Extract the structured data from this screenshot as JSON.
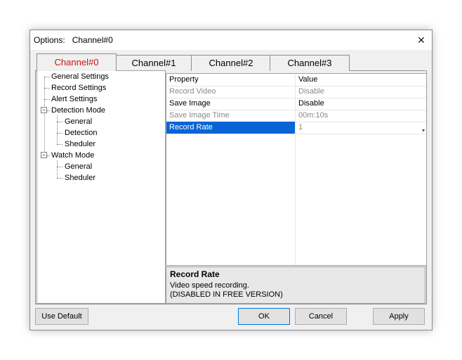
{
  "window": {
    "title": "Options:   Channel#0",
    "close_glyph": "✕"
  },
  "tabs": [
    {
      "label": "Channel#0",
      "active": true
    },
    {
      "label": "Channel#1",
      "active": false
    },
    {
      "label": "Channel#2",
      "active": false
    },
    {
      "label": "Channel#3",
      "active": false
    }
  ],
  "tree": {
    "items": [
      {
        "label": "General Settings"
      },
      {
        "label": "Record Settings"
      },
      {
        "label": "Alert Settings"
      },
      {
        "label": "Detection Mode",
        "expanded": true,
        "expander": "−"
      },
      {
        "label": "General"
      },
      {
        "label": "Detection"
      },
      {
        "label": "Sheduler"
      },
      {
        "label": "Watch Mode",
        "expanded": true,
        "expander": "−"
      },
      {
        "label": "General"
      },
      {
        "label": "Sheduler"
      }
    ]
  },
  "grid": {
    "headers": {
      "property": "Property",
      "value": "Value"
    },
    "rows": [
      {
        "property": "Record Video",
        "value": "Disable",
        "disabled": true
      },
      {
        "property": "Save Image",
        "value": "Disable",
        "disabled": false
      },
      {
        "property": "Save Image Time",
        "value": "00m:10s",
        "disabled": true
      },
      {
        "property": "Record Rate",
        "value": "1",
        "disabled": true,
        "selected": true,
        "dropdown": "▾"
      }
    ]
  },
  "description": {
    "title": "Record Rate",
    "line1": "Video speed recording.",
    "line2": "(DISABLED IN FREE VERSION)"
  },
  "buttons": {
    "use_default": "Use Default",
    "ok": "OK",
    "cancel": "Cancel",
    "apply": "Apply"
  },
  "colors": {
    "active_tab_text": "#d01010",
    "selection": "#0a64d6"
  }
}
